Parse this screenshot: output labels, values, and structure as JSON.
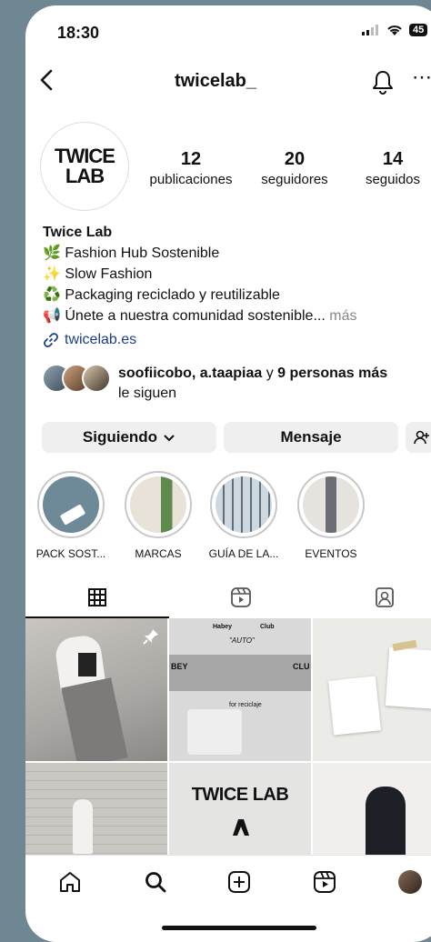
{
  "status_bar": {
    "time": "18:30",
    "battery": "45"
  },
  "header": {
    "username": "twicelab_"
  },
  "profile": {
    "avatar_text_line1": "TWICE",
    "avatar_text_line2": "LAB",
    "stats": [
      {
        "value": "12",
        "label": "publicaciones"
      },
      {
        "value": "20",
        "label": "seguidores"
      },
      {
        "value": "14",
        "label": "seguidos"
      }
    ]
  },
  "bio": {
    "name": "Twice Lab",
    "lines": [
      {
        "emoji": "🌿",
        "text": "Fashion Hub Sostenible"
      },
      {
        "emoji": "✨",
        "text": "Slow Fashion"
      },
      {
        "emoji": "♻️",
        "text": "Packaging reciclado y reutilizable"
      },
      {
        "emoji": "📢",
        "text": "Únete a nuestra comunidad sostenible...",
        "more": "más"
      }
    ],
    "link": "twicelab.es"
  },
  "followed_by": {
    "names": "soofiicobo, a.taapiaa",
    "connector": "y",
    "others": "9 personas más",
    "suffix": "le siguen"
  },
  "actions": {
    "following": "Siguiendo",
    "message": "Mensaje"
  },
  "highlights": [
    {
      "label": "PACK SOST..."
    },
    {
      "label": "MARCAS"
    },
    {
      "label": "GUÍA DE LA..."
    },
    {
      "label": "EVENTOS"
    }
  ],
  "grid": {
    "post5_text": "TWICE LAB",
    "post2_texts": [
      "Habey",
      "Club",
      "\"AUTO\"",
      "BEY",
      "CLU",
      "for reciclaje"
    ]
  },
  "colors": {
    "accent_link": "#1a3d8f",
    "button_bg": "#efefef",
    "background": "#6f8792"
  }
}
